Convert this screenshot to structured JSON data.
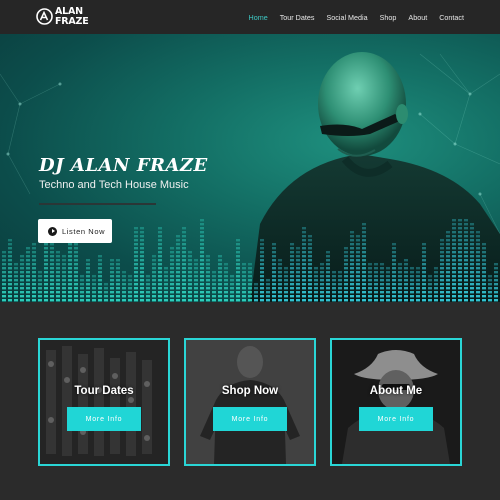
{
  "brand": {
    "logo_mark": "AF",
    "logo_line1": "ALAN",
    "logo_line2": "FRAZE"
  },
  "nav": {
    "items": [
      "Home",
      "Tour Dates",
      "Social Media",
      "Shop",
      "About",
      "Contact"
    ],
    "active": "Home"
  },
  "hero": {
    "title": "DJ ALAN FRAZE",
    "subtitle": "Techno and Tech House Music",
    "button_label": "Listen Now",
    "button_icon": "play-circle-icon"
  },
  "cards": [
    {
      "title": "Tour Dates",
      "button_label": "More Info",
      "image": "mixing-console-photo"
    },
    {
      "title": "Shop Now",
      "button_label": "More Info",
      "image": "tshirt-model-photo"
    },
    {
      "title": "About Me",
      "button_label": "More Info",
      "image": "cowboy-hat-photo"
    }
  ],
  "colors": {
    "accent": "#20d6d6",
    "nav_active": "#3ec9c5",
    "header_bg": "#262626",
    "page_bg": "#2b2b2b",
    "hero_teal": "#136e64"
  }
}
